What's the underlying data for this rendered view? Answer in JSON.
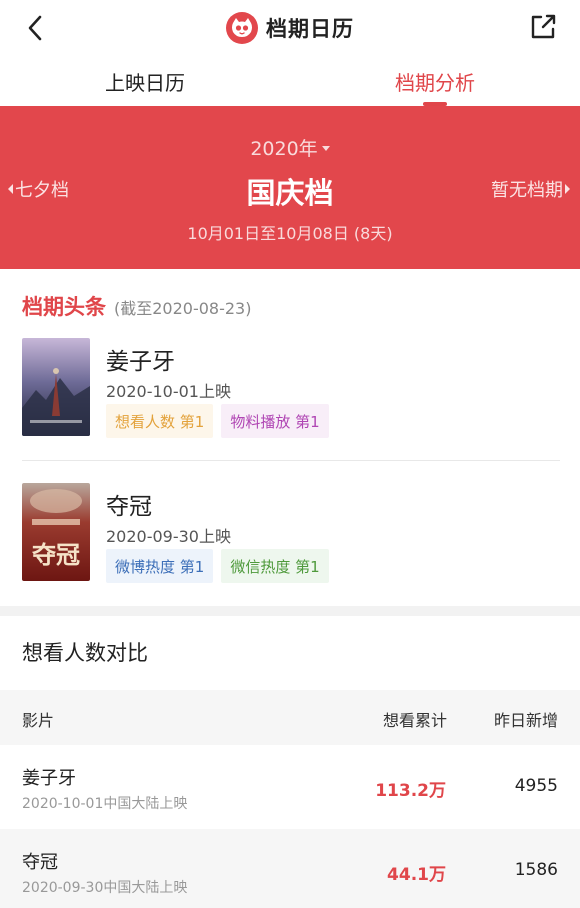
{
  "nav": {
    "title": "档期日历"
  },
  "tabs": [
    {
      "label": "上映日历",
      "active": false
    },
    {
      "label": "档期分析",
      "active": true
    }
  ],
  "banner": {
    "year": "2020年",
    "season": "国庆档",
    "prev_season": "七夕档",
    "next_season": "暂无档期",
    "date_range": "10月01日至10月08日 (8天)"
  },
  "headlines": {
    "title": "档期头条",
    "note": "(截至2020-08-23)",
    "movies": [
      {
        "title": "姜子牙",
        "release": "2020-10-01上映",
        "tags": [
          {
            "label": "想看人数 第1",
            "color": "orange"
          },
          {
            "label": "物料播放 第1",
            "color": "purple"
          }
        ]
      },
      {
        "title": "夺冠",
        "release": "2020-09-30上映",
        "poster_text": "夺冠",
        "tags": [
          {
            "label": "微博热度 第1",
            "color": "blue"
          },
          {
            "label": "微信热度 第1",
            "color": "green"
          }
        ]
      }
    ]
  },
  "compare": {
    "title": "想看人数对比",
    "columns": {
      "film": "影片",
      "total": "想看累计",
      "new": "昨日新增"
    },
    "rows": [
      {
        "name": "姜子牙",
        "sub": "2020-10-01中国大陆上映",
        "total": "113.2万",
        "new": "4955"
      },
      {
        "name": "夺冠",
        "sub": "2020-09-30中国大陆上映",
        "total": "44.1万",
        "new": "1586"
      }
    ]
  },
  "colors": {
    "accent": "#e0464a",
    "banner": "#e2474c"
  }
}
